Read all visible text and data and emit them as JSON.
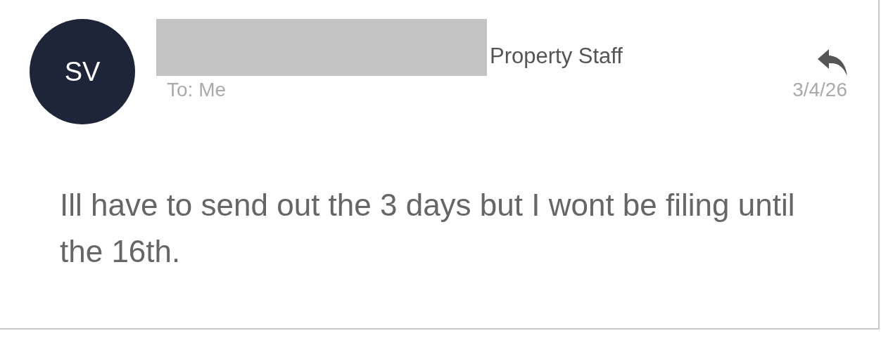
{
  "message": {
    "avatar": "SV",
    "sender_redacted": true,
    "sender_role": "Property Staff",
    "recipient": "To: Me",
    "date": "3/4/26",
    "body": "Ill have to send out the 3 days but I wont be filing until the 16th."
  }
}
